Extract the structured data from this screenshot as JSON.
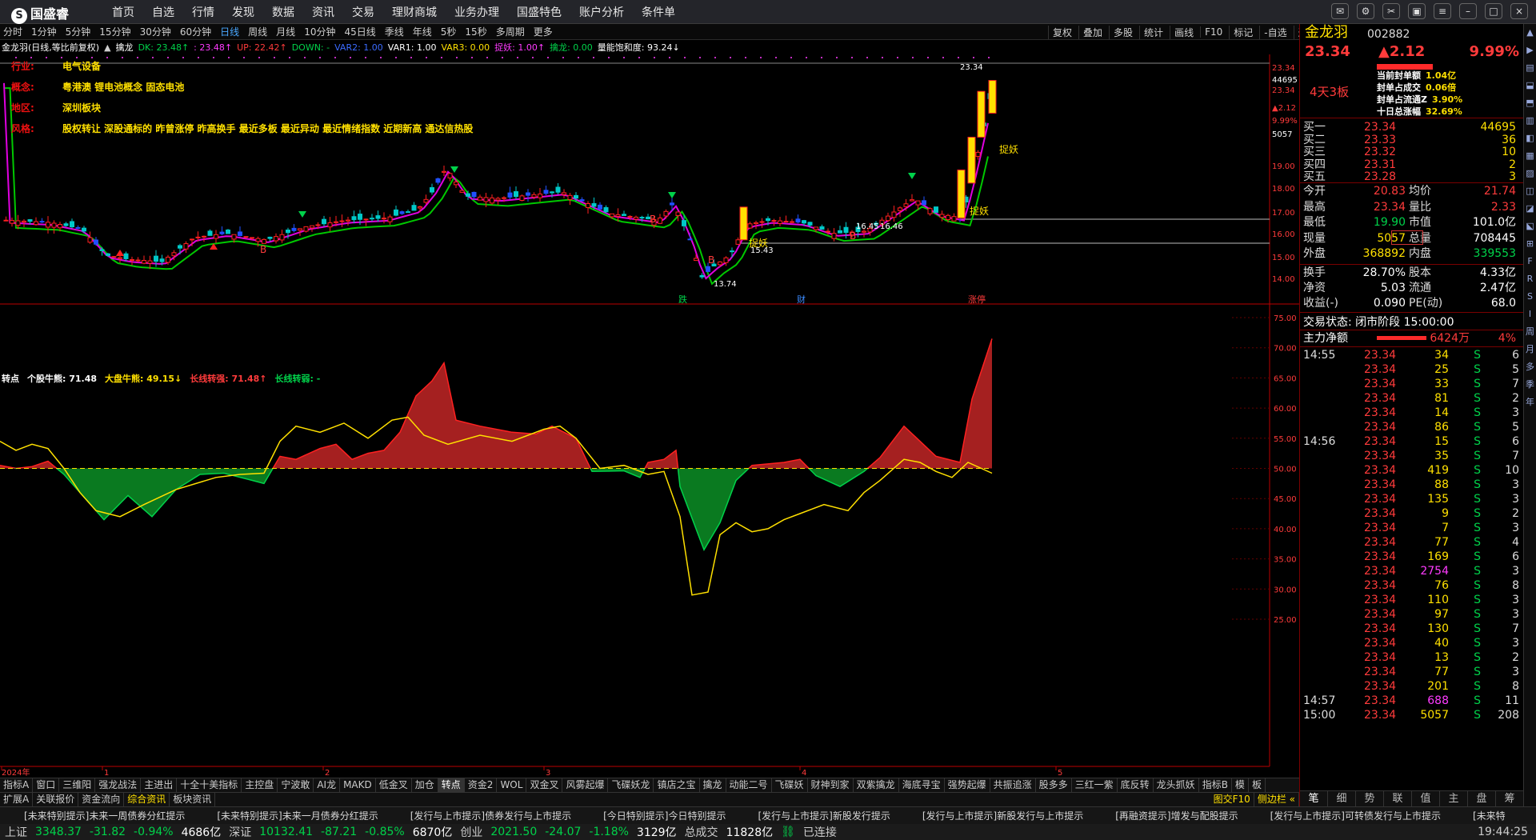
{
  "app": {
    "logo": "国盛睿",
    "menu": [
      "首页",
      "自选",
      "行情",
      "发现",
      "数据",
      "资讯",
      "交易",
      "理财商城",
      "业务办理",
      "国盛特色",
      "账户分析",
      "条件单"
    ]
  },
  "period_tabs": [
    "分时",
    "1分钟",
    "5分钟",
    "15分钟",
    "30分钟",
    "60分钟",
    "日线",
    "周线",
    "月线",
    "10分钟",
    "45日线",
    "季线",
    "年线",
    "5秒",
    "15秒",
    "多周期",
    "更多"
  ],
  "active_period": "日线",
  "toolbar_right": [
    "复权",
    "叠加",
    "多股",
    "统计",
    "画线",
    "F10",
    "标记",
    "-自选",
    "返回"
  ],
  "indicator_line": [
    {
      "t": "金龙羽(日线,等比前复权)",
      "c": "#ffffff"
    },
    {
      "t": "▲",
      "c": "#cfcfcf"
    },
    {
      "t": "擒龙",
      "c": "#ffffff"
    },
    {
      "t": "DK: 23.48↑",
      "c": "#00d24a"
    },
    {
      "t": ": 23.48↑",
      "c": "#ff3bff"
    },
    {
      "t": "UP: 22.42↑",
      "c": "#ff3b3b"
    },
    {
      "t": "DOWN: -",
      "c": "#00d24a"
    },
    {
      "t": "VAR2: 1.00",
      "c": "#3b6bff"
    },
    {
      "t": "VAR1: 1.00",
      "c": "#ffffff"
    },
    {
      "t": "VAR3: 0.00",
      "c": "#ffe000"
    },
    {
      "t": "捉妖: 1.00↑",
      "c": "#ff3bff"
    },
    {
      "t": "擒龙: 0.00",
      "c": "#00d24a"
    },
    {
      "t": "量能饱和度: 93.24↓",
      "c": "#ffffff"
    }
  ],
  "info": [
    {
      "k": "行业:",
      "v": "电气设备"
    },
    {
      "k": "概念:",
      "v": "粤港澳 锂电池概念 固态电池"
    },
    {
      "k": "地区:",
      "v": "深圳板块"
    },
    {
      "k": "风格:",
      "v": "股权转让 深股通标的 昨曾涨停 昨高换手 最近多板 最近异动 最近情绪指数 近期新高 通达信热股"
    }
  ],
  "chart_labels": {
    "high": "23.34",
    "low": "13.74",
    "mid1": "15.43",
    "mid2": "16.45",
    "mid3": "16.46",
    "zhuoyao": "捉妖",
    "b": "B",
    "die": "跌",
    "cai": "财",
    "zhangting": "涨停"
  },
  "price_axis": [
    "23.34",
    "44695",
    "23.34",
    "▲2.12",
    "9.99%",
    "5057",
    "19.00",
    "18.00",
    "17.00",
    "16.00",
    "15.00",
    "14.00"
  ],
  "lower_header": [
    {
      "t": "转点",
      "c": "#ffffff"
    },
    {
      "t": "个股牛熊: 71.48",
      "c": "#ffffff"
    },
    {
      "t": "大盘牛熊: 49.15↓",
      "c": "#ffe000"
    },
    {
      "t": "长线转强: 71.48↑",
      "c": "#ff3b3b"
    },
    {
      "t": "长线转弱: -",
      "c": "#00d24a"
    }
  ],
  "lower_axis": [
    "75.00",
    "70.00",
    "65.00",
    "60.00",
    "55.00",
    "50.00",
    "45.00",
    "40.00",
    "35.00",
    "30.00",
    "25.00"
  ],
  "x_axis": [
    "2024年",
    "1",
    "2",
    "3",
    "4",
    "5"
  ],
  "tabs1": [
    "指标A",
    "窗口",
    "三维阳",
    "强龙战法",
    "主进出",
    "十全十美指标",
    "主控盘",
    "宁波敢",
    "AI龙",
    "MAKD",
    "低金叉",
    "加仓",
    "转点",
    "资金2",
    "WOL",
    "双金叉",
    "风雾起爆",
    "飞碟妖龙",
    "镇店之宝",
    "擒龙",
    "动能二号",
    "飞碟妖",
    "财神到家",
    "双紫擒龙",
    "海底寻宝",
    "强势起爆",
    "共振追涨",
    "股多多",
    "三红一紫",
    "底反转",
    "龙头抓妖",
    "指标B",
    "模",
    "板"
  ],
  "tabs1_active": "转点",
  "tabs2": [
    "扩展A",
    "关联报价",
    "资金流向",
    "综合资讯",
    "板块资讯"
  ],
  "tabs2_right": [
    "图交F10",
    "侧边栏 «"
  ],
  "news": [
    "[未来特别提示]未来一周债券分红提示",
    "[未来特别提示]未来一月债券分红提示",
    "[发行与上市提示]债券发行与上市提示",
    "[今日特别提示]今日特别提示",
    "[发行与上市提示]新股发行提示",
    "[发行与上市提示]新股发行与上市提示",
    "[再融资提示]增发与配股提示",
    "[发行与上市提示]可转债发行与上市提示",
    "[未来特"
  ],
  "status": {
    "sh": "上证",
    "sh_v": "3348.37",
    "sh_c": "-31.82",
    "sh_p": "-0.94%",
    "sh_a": "4686亿",
    "sz": "深证",
    "sz_v": "10132.41",
    "sz_c": "-87.21",
    "sz_p": "-0.85%",
    "sz_a": "6870亿",
    "cy": "创业",
    "cy_v": "2021.50",
    "cy_c": "-24.07",
    "cy_p": "-1.18%",
    "cy_a": "3129亿",
    "tot": "总成交",
    "tot_v": "11828亿",
    "conn": "已连接",
    "time": "19:44:25"
  },
  "stock": {
    "name": "金龙羽",
    "code": "002882",
    "price": "23.34",
    "chg": "▲2.12",
    "pct": "9.99%",
    "board": "4天3板",
    "seal": [
      {
        "k": "当前封单额",
        "v": "1.04亿"
      },
      {
        "k": "封单占成交",
        "v": "0.06倍"
      },
      {
        "k": "封单占流通Z",
        "v": "3.90%"
      },
      {
        "k": "十日总涨幅",
        "v": "32.69%"
      }
    ],
    "order": [
      {
        "k": "买一",
        "p": "23.34",
        "v": "44695"
      },
      {
        "k": "买二",
        "p": "23.33",
        "v": "36"
      },
      {
        "k": "买三",
        "p": "23.32",
        "v": "10"
      },
      {
        "k": "买四",
        "p": "23.31",
        "v": "2"
      },
      {
        "k": "买五",
        "p": "23.28",
        "v": "3"
      }
    ],
    "quote": [
      {
        "k1": "今开",
        "v1": "20.83",
        "k2": "均价",
        "v2": "21.74"
      },
      {
        "k1": "最高",
        "v1": "23.34",
        "k2": "量比",
        "v2": "2.33"
      },
      {
        "k1": "最低",
        "v1": "19.90",
        "k2": "市值",
        "v2": "101.0亿"
      },
      {
        "k1": "现量",
        "v1": "5057",
        "k2": "总量",
        "v2": "708445"
      },
      {
        "k1": "外盘",
        "v1": "368892",
        "k2": "内盘",
        "v2": "339553"
      }
    ],
    "stats": [
      {
        "k1": "换手",
        "v1": "28.70%",
        "k2": "股本",
        "v2": "4.33亿"
      },
      {
        "k1": "净资",
        "v1": "5.03",
        "k2": "流通",
        "v2": "2.47亿"
      },
      {
        "k1": "收益(-)",
        "v1": "0.090",
        "k2": "PE(动)",
        "v2": "68.0"
      }
    ],
    "trade_state": "交易状态: 闭市阶段 15:00:00",
    "netflow_label": "主力净额",
    "netflow_value": "6424万",
    "netflow_pct": "4%",
    "ticks": [
      {
        "t": "14:55",
        "p": "23.34",
        "v": "34",
        "s": "S",
        "n": "6"
      },
      {
        "t": "",
        "p": "23.34",
        "v": "25",
        "s": "S",
        "n": "5"
      },
      {
        "t": "",
        "p": "23.34",
        "v": "33",
        "s": "S",
        "n": "7"
      },
      {
        "t": "",
        "p": "23.34",
        "v": "81",
        "s": "S",
        "n": "2"
      },
      {
        "t": "",
        "p": "23.34",
        "v": "14",
        "s": "S",
        "n": "3"
      },
      {
        "t": "",
        "p": "23.34",
        "v": "86",
        "s": "S",
        "n": "5"
      },
      {
        "t": "14:56",
        "p": "23.34",
        "v": "15",
        "s": "S",
        "n": "6"
      },
      {
        "t": "",
        "p": "23.34",
        "v": "35",
        "s": "S",
        "n": "7"
      },
      {
        "t": "",
        "p": "23.34",
        "v": "419",
        "s": "S",
        "n": "10"
      },
      {
        "t": "",
        "p": "23.34",
        "v": "88",
        "s": "S",
        "n": "3"
      },
      {
        "t": "",
        "p": "23.34",
        "v": "135",
        "s": "S",
        "n": "3"
      },
      {
        "t": "",
        "p": "23.34",
        "v": "9",
        "s": "S",
        "n": "2"
      },
      {
        "t": "",
        "p": "23.34",
        "v": "7",
        "s": "S",
        "n": "3"
      },
      {
        "t": "",
        "p": "23.34",
        "v": "77",
        "s": "S",
        "n": "4"
      },
      {
        "t": "",
        "p": "23.34",
        "v": "169",
        "s": "S",
        "n": "6"
      },
      {
        "t": "",
        "p": "23.34",
        "v": "2754",
        "s": "S",
        "n": "3"
      },
      {
        "t": "",
        "p": "23.34",
        "v": "76",
        "s": "S",
        "n": "8"
      },
      {
        "t": "",
        "p": "23.34",
        "v": "110",
        "s": "S",
        "n": "3"
      },
      {
        "t": "",
        "p": "23.34",
        "v": "97",
        "s": "S",
        "n": "3"
      },
      {
        "t": "",
        "p": "23.34",
        "v": "130",
        "s": "S",
        "n": "7"
      },
      {
        "t": "",
        "p": "23.34",
        "v": "40",
        "s": "S",
        "n": "3"
      },
      {
        "t": "",
        "p": "23.34",
        "v": "13",
        "s": "S",
        "n": "2"
      },
      {
        "t": "",
        "p": "23.34",
        "v": "77",
        "s": "S",
        "n": "3"
      },
      {
        "t": "",
        "p": "23.34",
        "v": "201",
        "s": "S",
        "n": "8"
      },
      {
        "t": "14:57",
        "p": "23.34",
        "v": "688",
        "s": "S",
        "n": "11"
      },
      {
        "t": "15:00",
        "p": "23.34",
        "v": "5057",
        "s": "S",
        "n": "208"
      }
    ],
    "bottom_tabs": [
      "笔",
      "细",
      "势",
      "联",
      "值",
      "主",
      "盘",
      "筹"
    ]
  },
  "sidebar": [
    "F",
    "R",
    "S",
    "I",
    "周",
    "月",
    "多",
    "季",
    "年"
  ],
  "chart_data": {
    "type": "candlestick",
    "title": "金龙羽(日线,等比前复权)",
    "price_ylim": [
      13.5,
      24.2
    ],
    "oscillator_ylim": [
      25,
      75
    ],
    "x_ticks": [
      "2024年",
      "1",
      "2",
      "3",
      "4",
      "5"
    ],
    "last_close": 23.34,
    "high_label": 23.34,
    "low_label": 13.74,
    "annotations": [
      15.43,
      16.45,
      16.46
    ],
    "series": [
      {
        "name": "个股牛熊",
        "last": 71.48
      },
      {
        "name": "大盘牛熊",
        "last": 49.15
      },
      {
        "name": "长线转强",
        "last": 71.48
      }
    ]
  }
}
